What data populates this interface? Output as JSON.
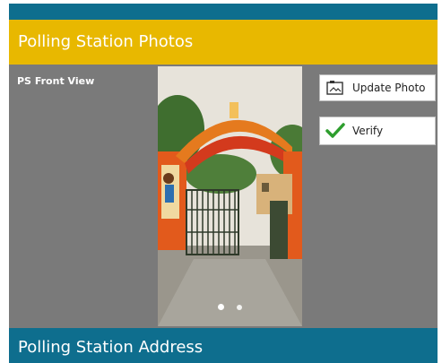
{
  "header": {
    "title": "Polling Station Photos"
  },
  "photo_panel": {
    "label": "PS Front View",
    "carousel": {
      "total_pages": 2,
      "active_page": 1
    }
  },
  "actions": {
    "update_label": "Update Photo",
    "verify_label": "Verify"
  },
  "footer": {
    "title": "Polling Station Address"
  },
  "colors": {
    "accent_yellow": "#e8b800",
    "teal": "#0e6e8e",
    "panel_gray": "#7a7a7a",
    "check_green": "#2e9e2e"
  }
}
